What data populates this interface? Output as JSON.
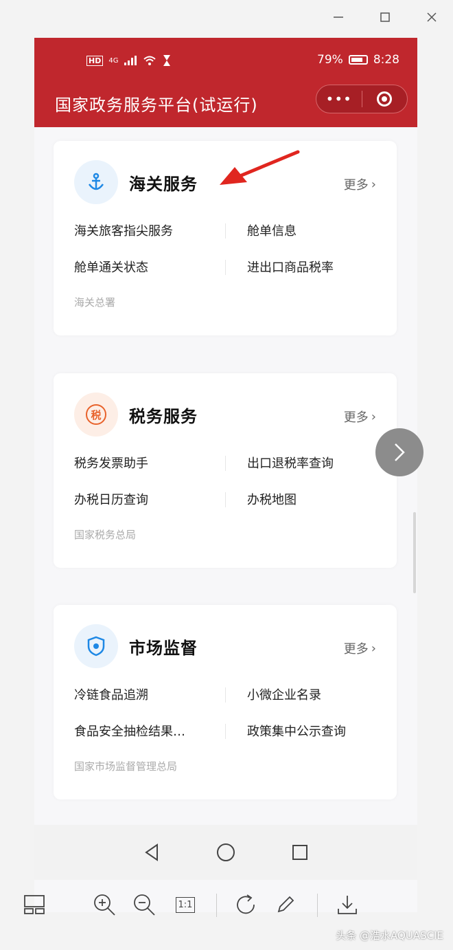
{
  "status_bar": {
    "battery": "79%",
    "time": "8:28",
    "hd": "HD",
    "signal": "4G"
  },
  "app": {
    "title": "国家政务服务平台(试运行)",
    "more_label": "•••"
  },
  "cards": [
    {
      "title": "海关服务",
      "more": "更多",
      "items": [
        "海关旅客指尖服务",
        "舱单信息",
        "舱单通关状态",
        "进出口商品税率"
      ],
      "org": "海关总署",
      "accent": "#1e88e5",
      "icon": "anchor-icon"
    },
    {
      "title": "税务服务",
      "more": "更多",
      "items": [
        "税务发票助手",
        "出口退税率查询",
        "办税日历查询",
        "办税地图"
      ],
      "org": "国家税务总局",
      "accent": "#e8622b",
      "icon": "tax-icon",
      "icon_text": "税"
    },
    {
      "title": "市场监督",
      "more": "更多",
      "items": [
        "冷链食品追溯",
        "小微企业名录",
        "食品安全抽检结果…",
        "政策集中公示查询"
      ],
      "org": "国家市场监督管理总局",
      "accent": "#1e88e5",
      "icon": "shield-icon"
    }
  ],
  "toolbar": {
    "zoom_ratio": "1:1"
  },
  "watermark": "头条 @浩水AQUASCIE",
  "colors": {
    "header_red": "#c0272d",
    "arrow_red": "#e0261f"
  }
}
